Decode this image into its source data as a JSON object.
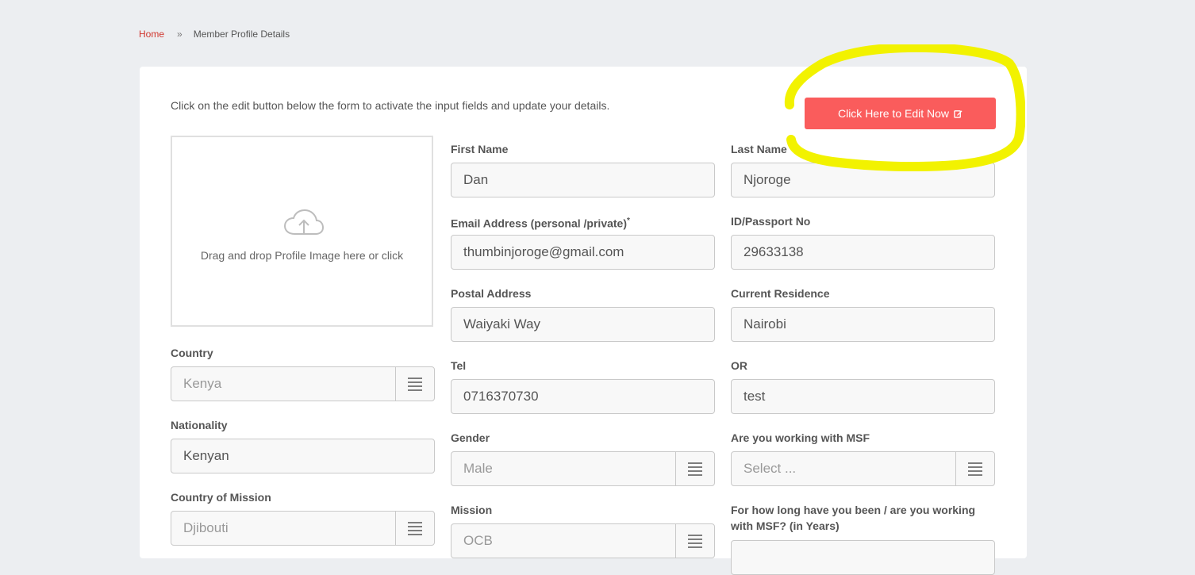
{
  "breadcrumb": {
    "home": "Home",
    "separator": "»",
    "current": "Member Profile Details"
  },
  "intro_text": "Click on the edit button below the form to activate the input fields and update your details.",
  "edit_button": {
    "label": "Click Here to Edit Now",
    "icon": "edit-icon",
    "color": "#fa5c5c"
  },
  "highlight_color": "#f2f200",
  "dropzone": {
    "icon": "cloud-upload-icon",
    "text": "Drag and drop Profile Image here or click"
  },
  "fields": {
    "first_name": {
      "label": "First Name",
      "value": "Dan"
    },
    "last_name": {
      "label": "Last Name",
      "value": "Njoroge"
    },
    "email": {
      "label": "Email Address (personal /private)",
      "required_mark": "*",
      "value": "thumbinjoroge@gmail.com"
    },
    "id_passport": {
      "label": "ID/Passport No",
      "value": "29633138"
    },
    "postal_address": {
      "label": "Postal Address",
      "value": "Waiyaki Way"
    },
    "current_residence": {
      "label": "Current Residence",
      "value": "Nairobi"
    },
    "tel": {
      "label": "Tel",
      "value": "0716370730"
    },
    "or": {
      "label": "OR",
      "value": "test"
    },
    "country": {
      "label": "Country",
      "value": "Kenya"
    },
    "nationality": {
      "label": "Nationality",
      "value": "Kenyan"
    },
    "gender": {
      "label": "Gender",
      "value": "Male"
    },
    "working_msf": {
      "label": "Are you working with MSF",
      "placeholder": "Select ..."
    },
    "country_of_mission": {
      "label": "Country of Mission",
      "value": "Djibouti"
    },
    "mission": {
      "label": "Mission",
      "value": "OCB"
    },
    "msf_years": {
      "label_line1": "For how long have you been / are you working",
      "label_line2": "with MSF? (in Years)"
    }
  }
}
